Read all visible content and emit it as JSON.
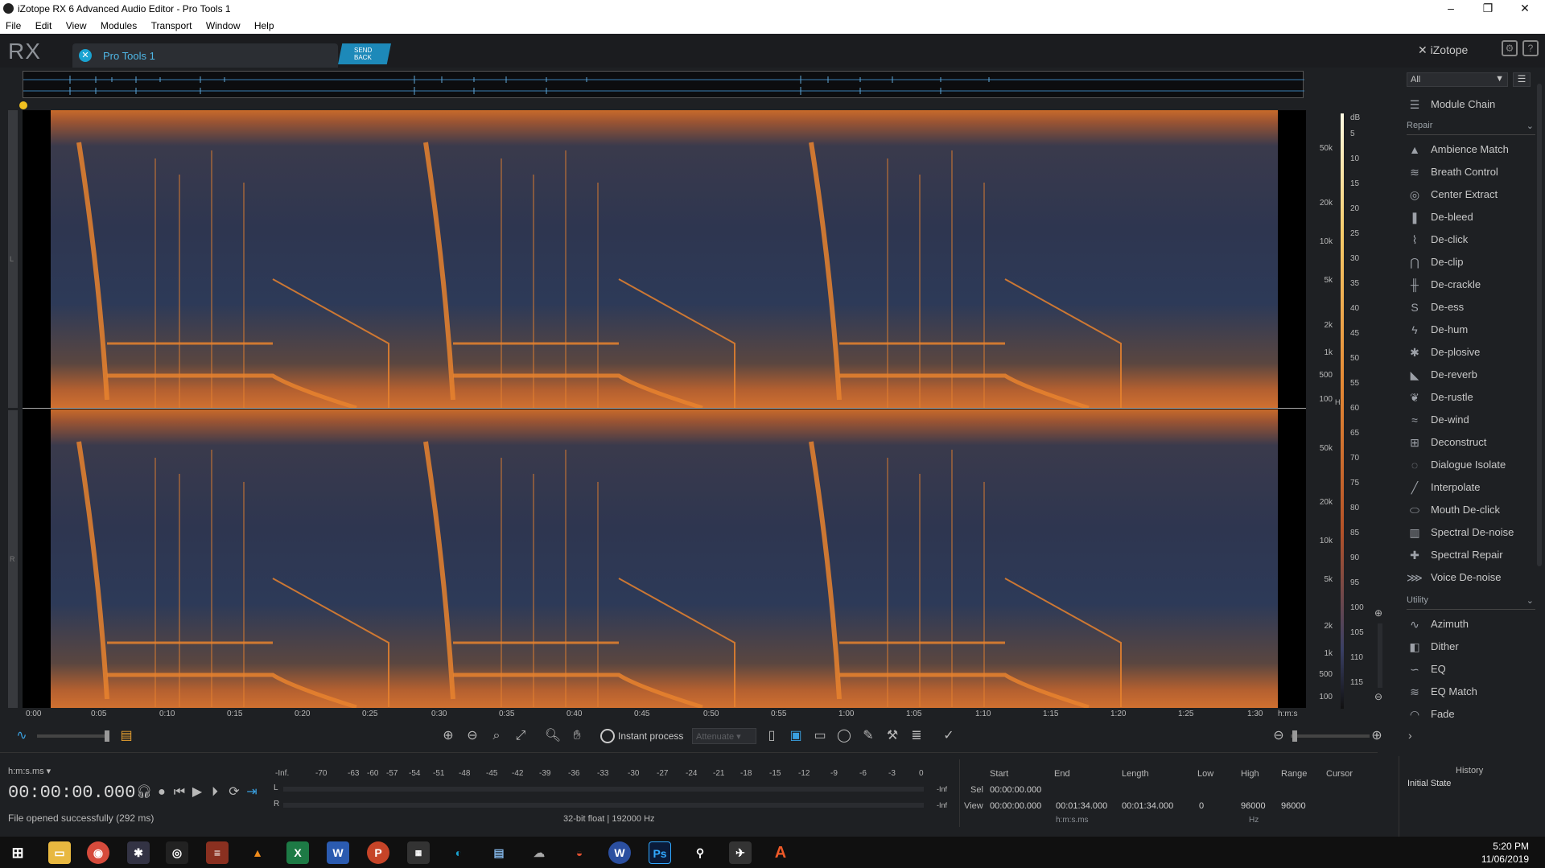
{
  "window": {
    "title": "iZotope RX 6 Advanced Audio Editor - Pro Tools 1",
    "controls": {
      "minimize": "–",
      "restore": "❐",
      "close": "✕"
    }
  },
  "menu": [
    "File",
    "Edit",
    "View",
    "Modules",
    "Transport",
    "Window",
    "Help"
  ],
  "app": {
    "logo": "RX",
    "tab_label": "Pro Tools 1",
    "send_back": [
      "SEND",
      "BACK"
    ],
    "brand": "iZotope"
  },
  "channels": [
    "L",
    "R"
  ],
  "freq_axis": {
    "upper": [
      "50k",
      "20k",
      "10k",
      "5k",
      "2k",
      "1k",
      "500",
      "100"
    ],
    "lower": [
      "50k",
      "20k",
      "10k",
      "5k",
      "2k",
      "1k",
      "500",
      "100"
    ],
    "unit": "Hz"
  },
  "db_axis": {
    "unit": "dB",
    "ticks": [
      "5",
      "10",
      "15",
      "20",
      "25",
      "30",
      "35",
      "40",
      "45",
      "50",
      "55",
      "60",
      "65",
      "70",
      "75",
      "80",
      "85",
      "90",
      "95",
      "100",
      "105",
      "110",
      "115"
    ]
  },
  "time_axis": {
    "ticks": [
      "0:00",
      "0:05",
      "0:10",
      "0:15",
      "0:20",
      "0:25",
      "0:30",
      "0:35",
      "0:40",
      "0:45",
      "0:50",
      "0:55",
      "1:00",
      "1:05",
      "1:10",
      "1:15",
      "1:20",
      "1:25",
      "1:30"
    ],
    "unit": "h:m:s"
  },
  "toolbar": {
    "instant_process": "Instant process",
    "mode": "Attenuate"
  },
  "status": {
    "time_format": "h:m:s.ms ▾",
    "timecode": "00:00:00.000",
    "message": "File opened successfully (292 ms)",
    "format": "32-bit float | 192000 Hz"
  },
  "meter": {
    "scale": [
      "-Inf.",
      "-70",
      "-63",
      "-60",
      "-57",
      "-54",
      "-51",
      "-48",
      "-45",
      "-42",
      "-39",
      "-36",
      "-33",
      "-30",
      "-27",
      "-24",
      "-21",
      "-18",
      "-15",
      "-12",
      "-9",
      "-6",
      "-3",
      "0"
    ],
    "left_label": "L",
    "right_label": "R",
    "left_value": "-Inf",
    "right_value": "-Inf"
  },
  "selection": {
    "headers": [
      "Start",
      "End",
      "Length",
      "Low",
      "High",
      "Range",
      "Cursor"
    ],
    "sel_label": "Sel",
    "sel_start": "00:00:00.000",
    "view_label": "View",
    "view_start": "00:00:00.000",
    "view_end": "00:01:34.000",
    "view_length": "00:01:34.000",
    "low": "0",
    "high": "96000",
    "range": "96000",
    "time_unit": "h:m:s.ms",
    "freq_unit": "Hz"
  },
  "modules": {
    "filter": "All",
    "module_chain": "Module Chain",
    "repair_header": "Repair",
    "repair": [
      "Ambience Match",
      "Breath Control",
      "Center Extract",
      "De-bleed",
      "De-click",
      "De-clip",
      "De-crackle",
      "De-ess",
      "De-hum",
      "De-plosive",
      "De-reverb",
      "De-rustle",
      "De-wind",
      "Deconstruct",
      "Dialogue Isolate",
      "Interpolate",
      "Mouth De-click",
      "Spectral De-noise",
      "Spectral Repair",
      "Voice De-noise"
    ],
    "utility_header": "Utility",
    "utility": [
      "Azimuth",
      "Dither",
      "EQ",
      "EQ Match",
      "Fade"
    ]
  },
  "history": {
    "title": "History",
    "items": [
      "Initial State"
    ]
  },
  "clock": {
    "time": "5:20 PM",
    "date": "11/06/2019"
  }
}
